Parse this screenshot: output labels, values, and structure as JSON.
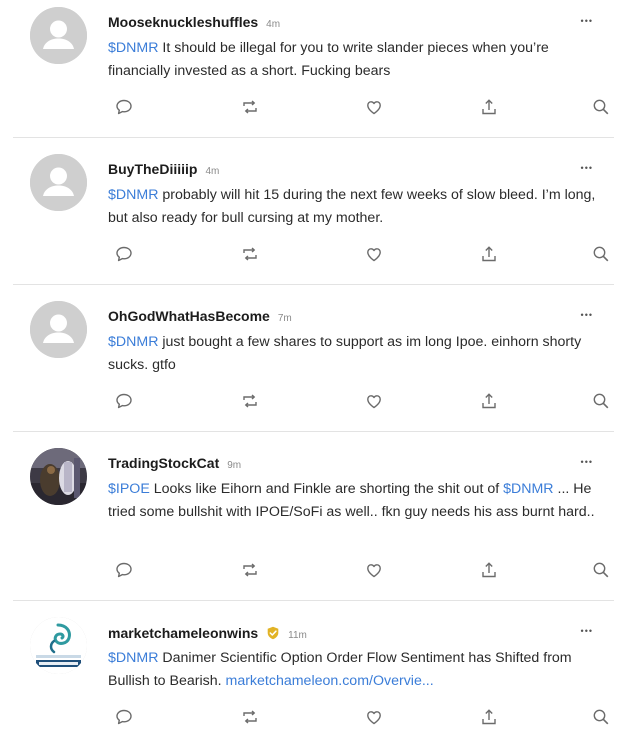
{
  "posts": [
    {
      "username": "Mooseknuckleshuffles",
      "time": "4m",
      "avatar": "default-avatar",
      "segments": [
        {
          "type": "ticker",
          "text": "$DNMR"
        },
        {
          "type": "text",
          "text": " It should be illegal for you to write slander pieces when you’re financially invested as a short. Fucking bears"
        }
      ]
    },
    {
      "username": "BuyTheDiiiiip",
      "time": "4m",
      "avatar": "default-avatar",
      "segments": [
        {
          "type": "ticker",
          "text": "$DNMR"
        },
        {
          "type": "text",
          "text": " probably will hit 15 during the next few weeks of slow bleed. I’m long, but also ready for bull cursing at my mother."
        }
      ]
    },
    {
      "username": "OhGodWhatHasBecome",
      "time": "7m",
      "avatar": "default-avatar",
      "segments": [
        {
          "type": "ticker",
          "text": "$DNMR"
        },
        {
          "type": "text",
          "text": " just bought a few shares to support as im long Ipoe. einhorn shorty sucks. gtfo"
        }
      ]
    },
    {
      "username": "TradingStockCat",
      "time": "9m",
      "avatar": "cat-photo-avatar",
      "segments": [
        {
          "type": "ticker",
          "text": "$IPOE"
        },
        {
          "type": "text",
          "text": " Looks like Eihorn and Finkle are shorting the shit out of "
        },
        {
          "type": "ticker",
          "text": "$DNMR"
        },
        {
          "type": "text",
          "text": " ... He tried some bullshit with IPOE/SoFi as well.. fkn guy needs his ass burnt hard.."
        }
      ]
    },
    {
      "username": "marketchameleonwins",
      "time": "11m",
      "verified": true,
      "avatar": "chameleon-logo-avatar",
      "segments": [
        {
          "type": "ticker",
          "text": "$DNMR"
        },
        {
          "type": "text",
          "text": " Danimer Scientific Option Order Flow Sentiment has Shifted from Bullish to Bearish. "
        },
        {
          "type": "link",
          "text": "marketchameleon.com/Overvie..."
        }
      ]
    }
  ],
  "ui": {
    "more_label": "•••",
    "actions": [
      "reply-icon",
      "reshare-icon",
      "like-icon",
      "share-icon",
      "search-icon"
    ],
    "colors": {
      "accent": "#3b7dd8",
      "icon": "#6b6b6b",
      "divider": "#e3e3e3",
      "verified": "#e2b325"
    }
  }
}
